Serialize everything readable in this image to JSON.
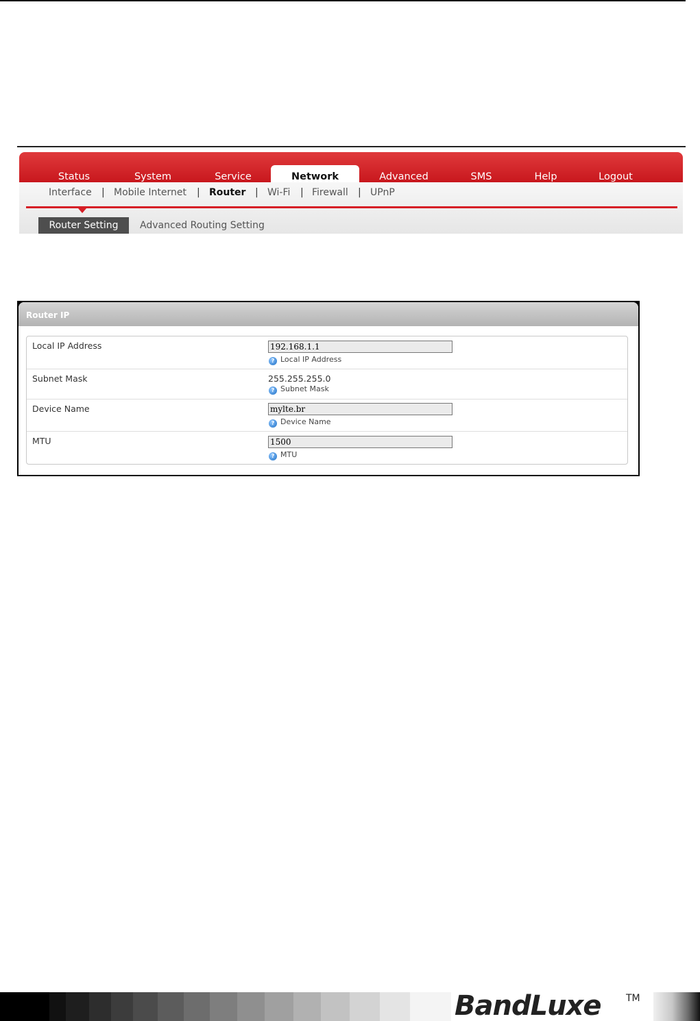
{
  "main_nav": [
    "Status",
    "System",
    "Service",
    "Network",
    "Advanced",
    "SMS",
    "Help",
    "Logout"
  ],
  "main_nav_active": "Network",
  "sub_nav": [
    "Interface",
    "Mobile Internet",
    "Router",
    "Wi-Fi",
    "Firewall",
    "UPnP"
  ],
  "sub_nav_separator": "|",
  "sub_nav_active": "Router",
  "tabs": [
    "Router Setting",
    "Advanced Routing Setting"
  ],
  "tab_active": "Router Setting",
  "panel": {
    "title": "Router IP",
    "rows": [
      {
        "label": "Local IP Address",
        "value": "192.168.1.1",
        "help": "Local IP Address"
      },
      {
        "label": "Subnet Mask",
        "value": "255.255.255.0",
        "help": "Subnet Mask"
      },
      {
        "label": "Device Name",
        "value": "mylte.br",
        "help": "Device Name"
      },
      {
        "label": "MTU",
        "value": "1500",
        "help": "MTU"
      }
    ]
  },
  "help_icon_glyph": "?",
  "footer": {
    "logo": "BandLuxe",
    "trademark": "TM"
  },
  "colors": {
    "accent_red": "#d61f26",
    "active_tab": "#4e4e4e"
  }
}
